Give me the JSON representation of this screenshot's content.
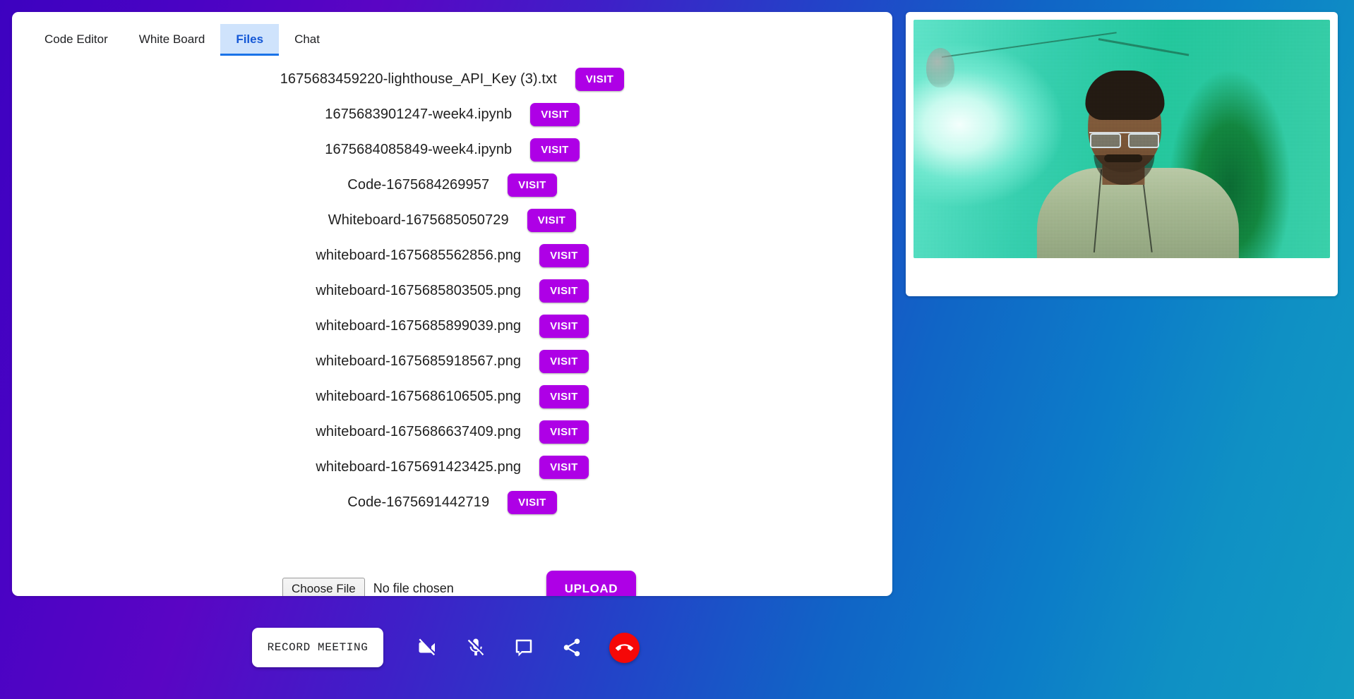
{
  "tabs": [
    {
      "label": "Code Editor",
      "active": false
    },
    {
      "label": "White Board",
      "active": false
    },
    {
      "label": "Files",
      "active": true
    },
    {
      "label": "Chat",
      "active": false
    }
  ],
  "files": {
    "visit_label": "VISIT",
    "items": [
      {
        "name": "1675683459220-lighthouse_API_Key (3).txt"
      },
      {
        "name": "1675683901247-week4.ipynb"
      },
      {
        "name": "1675684085849-week4.ipynb"
      },
      {
        "name": "Code-1675684269957"
      },
      {
        "name": "Whiteboard-1675685050729"
      },
      {
        "name": "whiteboard-1675685562856.png"
      },
      {
        "name": "whiteboard-1675685803505.png"
      },
      {
        "name": "whiteboard-1675685899039.png"
      },
      {
        "name": "whiteboard-1675685918567.png"
      },
      {
        "name": "whiteboard-1675686106505.png"
      },
      {
        "name": "whiteboard-1675686637409.png"
      },
      {
        "name": "whiteboard-1675691423425.png"
      },
      {
        "name": "Code-1675691442719"
      }
    ]
  },
  "upload": {
    "choose_file_label": "Choose File",
    "no_file_chosen": "No file chosen",
    "upload_label": "UPLOAD"
  },
  "controls": {
    "record_label": "RECORD MEETING",
    "video_off_icon": "videocam-off-icon",
    "mic_off_icon": "mic-off-icon",
    "chat_icon": "chat-bubble-icon",
    "share_icon": "share-icon",
    "end_call_icon": "end-call-icon"
  },
  "video": {
    "participant_feed": "webcam-video-feed"
  },
  "colors": {
    "accent_purple": "#ae00e6",
    "tab_active_bg": "#cfe3fc",
    "tab_active_text": "#1558d6",
    "end_call_red": "#f50808",
    "gradient_start": "#3d02c0",
    "gradient_end": "#129cc2"
  }
}
